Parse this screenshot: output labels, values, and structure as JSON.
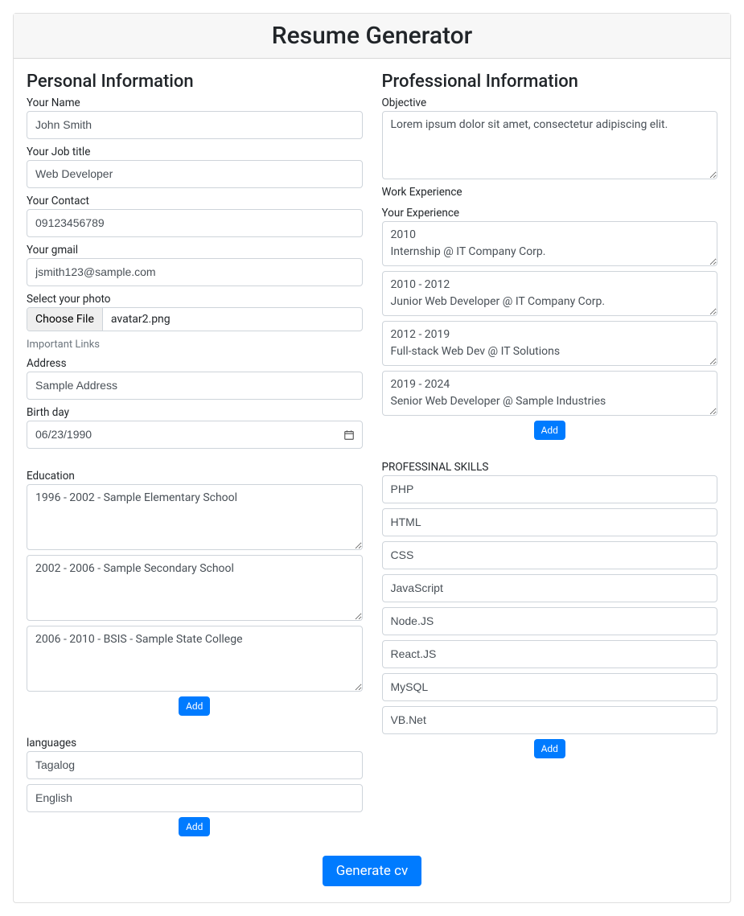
{
  "header": {
    "title": "Resume Generator"
  },
  "personal": {
    "heading": "Personal Information",
    "name_label": "Your Name",
    "name_value": "John Smith",
    "jobtitle_label": "Your Job title",
    "jobtitle_value": "Web Developer",
    "contact_label": "Your Contact",
    "contact_value": "09123456789",
    "gmail_label": "Your gmail",
    "gmail_value": "jsmith123@sample.com",
    "photo_label": "Select your photo",
    "photo_button": "Choose File",
    "photo_filename": "avatar2.png",
    "links_label": "Important Links",
    "address_label": "Address",
    "address_value": "Sample Address",
    "birthday_label": "Birth day",
    "birthday_value": "06/23/1990",
    "education_label": "Education",
    "education": [
      "1996 - 2002 - Sample Elementary School",
      "2002 - 2006 - Sample Secondary School",
      "2006 - 2010 - BSIS - Sample State College"
    ],
    "education_add": "Add",
    "languages_label": "languages",
    "languages": [
      "Tagalog",
      "English"
    ],
    "languages_add": "Add"
  },
  "professional": {
    "heading": "Professional Information",
    "objective_label": "Objective",
    "objective_value": "Lorem ipsum dolor sit amet, consectetur adipiscing elit.",
    "workexp_label": "Work Experience",
    "yourexp_label": "Your Experience",
    "experience": [
      "2010\nInternship @ IT Company Corp.",
      "2010 - 2012\nJunior Web Developer @ IT Company Corp.",
      "2012 - 2019\nFull-stack Web Dev @ IT Solutions",
      "2019 - 2024\nSenior Web Developer @ Sample Industries"
    ],
    "experience_add": "Add",
    "skills_label": "PROFESSINAL SKILLS",
    "skills": [
      "PHP",
      "HTML",
      "CSS",
      "JavaScript",
      "Node.JS",
      "React.JS",
      "MySQL",
      "VB.Net"
    ],
    "skills_add": "Add"
  },
  "footer": {
    "generate": "Generate cv"
  }
}
